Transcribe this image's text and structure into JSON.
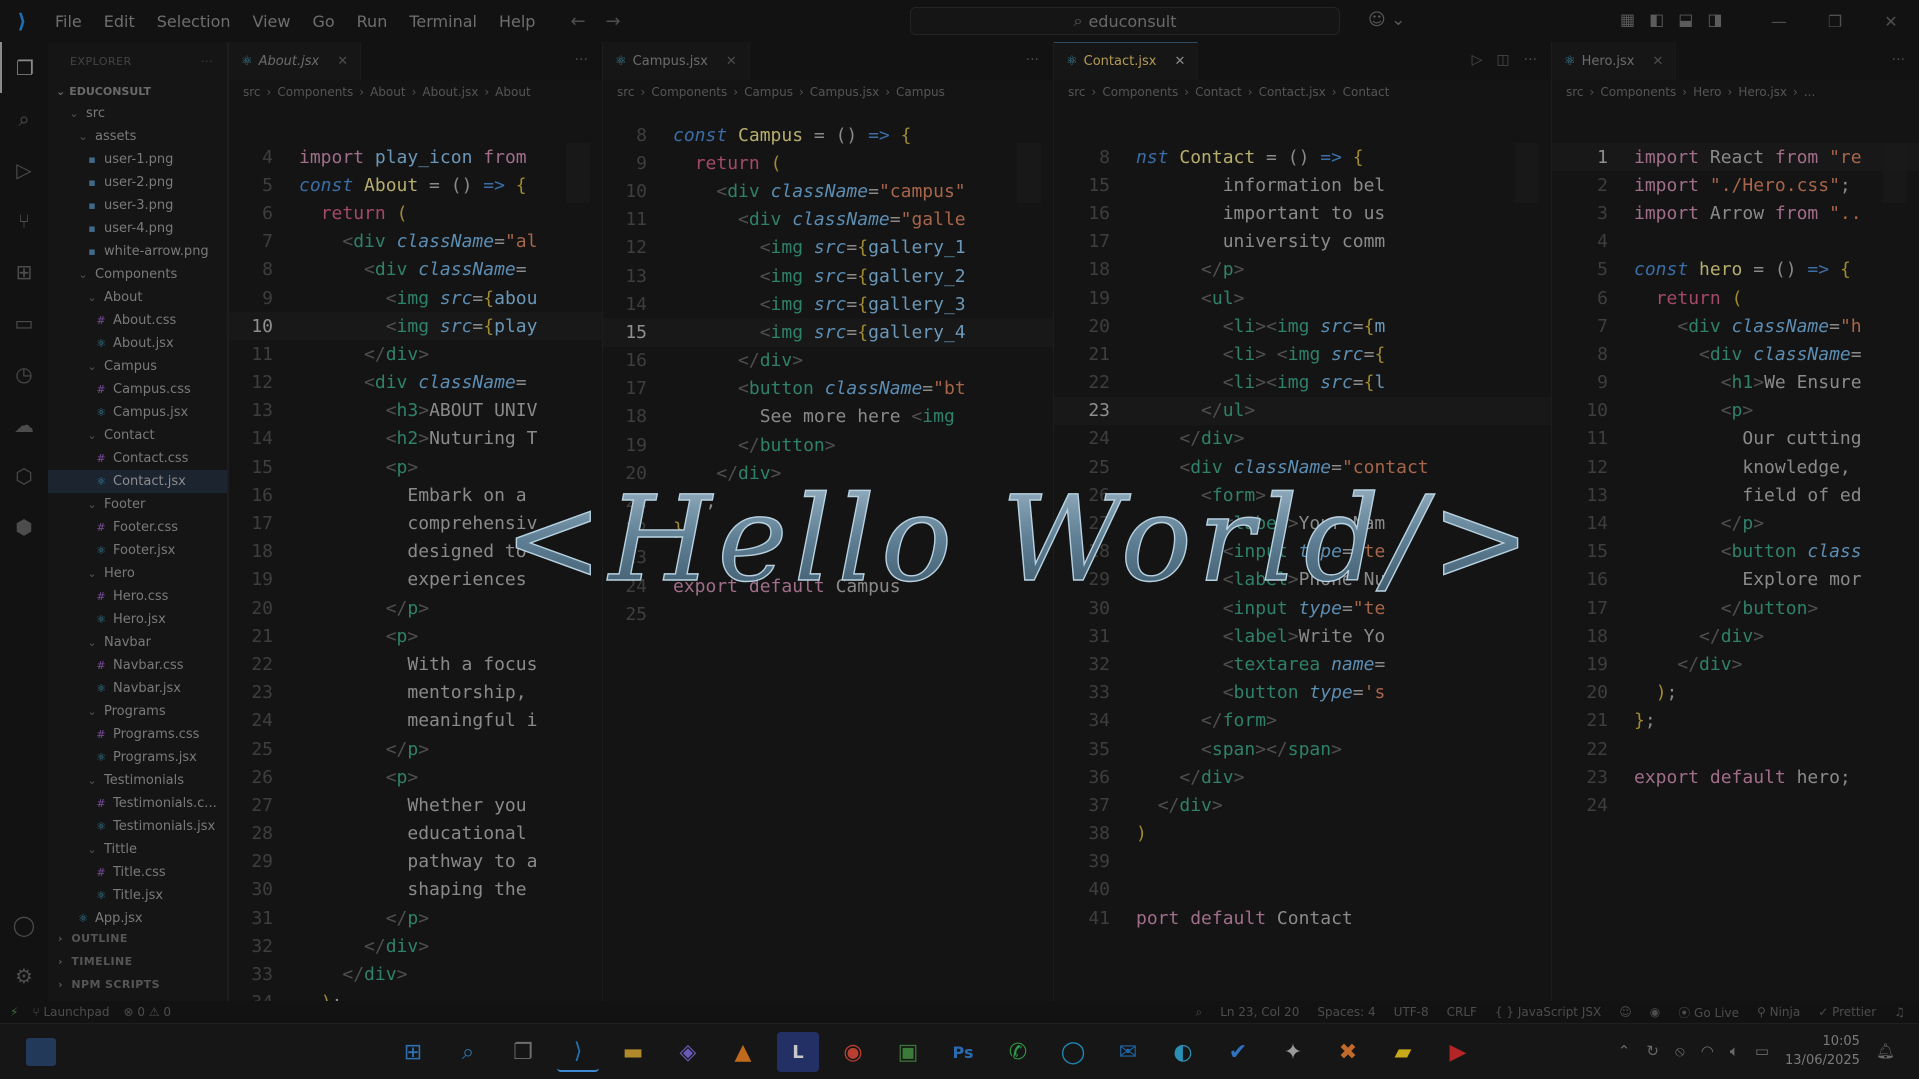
{
  "titlebar": {
    "menu": [
      "File",
      "Edit",
      "Selection",
      "View",
      "Go",
      "Run",
      "Terminal",
      "Help"
    ],
    "search": "educonsult"
  },
  "explorer": {
    "header": "EXPLORER",
    "root": "EDUCONSULT",
    "items": [
      {
        "label": "src",
        "depth": 1,
        "type": "folder-open"
      },
      {
        "label": "assets",
        "depth": 2,
        "type": "folder-open"
      },
      {
        "label": "user-1.png",
        "depth": 3,
        "type": "image"
      },
      {
        "label": "user-2.png",
        "depth": 3,
        "type": "image"
      },
      {
        "label": "user-3.png",
        "depth": 3,
        "type": "image"
      },
      {
        "label": "user-4.png",
        "depth": 3,
        "type": "image"
      },
      {
        "label": "white-arrow.png",
        "depth": 3,
        "type": "image"
      },
      {
        "label": "Components",
        "depth": 2,
        "type": "folder-open"
      },
      {
        "label": "About",
        "depth": 3,
        "type": "folder-open"
      },
      {
        "label": "About.css",
        "depth": 4,
        "type": "css"
      },
      {
        "label": "About.jsx",
        "depth": 4,
        "type": "jsx"
      },
      {
        "label": "Campus",
        "depth": 3,
        "type": "folder-open"
      },
      {
        "label": "Campus.css",
        "depth": 4,
        "type": "css"
      },
      {
        "label": "Campus.jsx",
        "depth": 4,
        "type": "jsx"
      },
      {
        "label": "Contact",
        "depth": 3,
        "type": "folder-open"
      },
      {
        "label": "Contact.css",
        "depth": 4,
        "type": "css"
      },
      {
        "label": "Contact.jsx",
        "depth": 4,
        "type": "jsx",
        "selected": true
      },
      {
        "label": "Footer",
        "depth": 3,
        "type": "folder-open"
      },
      {
        "label": "Footer.css",
        "depth": 4,
        "type": "css"
      },
      {
        "label": "Footer.jsx",
        "depth": 4,
        "type": "jsx"
      },
      {
        "label": "Hero",
        "depth": 3,
        "type": "folder-open"
      },
      {
        "label": "Hero.css",
        "depth": 4,
        "type": "css"
      },
      {
        "label": "Hero.jsx",
        "depth": 4,
        "type": "jsx"
      },
      {
        "label": "Navbar",
        "depth": 3,
        "type": "folder-open"
      },
      {
        "label": "Navbar.css",
        "depth": 4,
        "type": "css"
      },
      {
        "label": "Navbar.jsx",
        "depth": 4,
        "type": "jsx"
      },
      {
        "label": "Programs",
        "depth": 3,
        "type": "folder-open"
      },
      {
        "label": "Programs.css",
        "depth": 4,
        "type": "css"
      },
      {
        "label": "Programs.jsx",
        "depth": 4,
        "type": "jsx"
      },
      {
        "label": "Testimonials",
        "depth": 3,
        "type": "folder-open"
      },
      {
        "label": "Testimonials.c...",
        "depth": 4,
        "type": "css"
      },
      {
        "label": "Testimonials.jsx",
        "depth": 4,
        "type": "jsx"
      },
      {
        "label": "Tittle",
        "depth": 3,
        "type": "folder-open"
      },
      {
        "label": "Title.css",
        "depth": 4,
        "type": "css"
      },
      {
        "label": "Title.jsx",
        "depth": 4,
        "type": "jsx"
      },
      {
        "label": "App.jsx",
        "depth": 2,
        "type": "jsx"
      }
    ],
    "sections": [
      "OUTLINE",
      "TIMELINE",
      "NPM SCRIPTS"
    ]
  },
  "editors": [
    {
      "tab": "About.jsx",
      "crumbs": [
        "src",
        "Components",
        "About",
        "About.jsx",
        "About"
      ],
      "current_line": 10,
      "lines": [
        {
          "n": 4,
          "html": "<span class='k'>import</span> <span class='v'>play_icon</span> <span class='k'>from</span>"
        },
        {
          "n": 5,
          "html": "<span class='d'>const</span> <span class='fn'>About</span> = () <span class='d'>=&gt;</span> <span class='br'>{</span>"
        },
        {
          "n": 6,
          "html": "  <span class='ret'>return</span> <span class='br'>(</span>"
        },
        {
          "n": 7,
          "html": "    <span class='ang'>&lt;</span><span class='t'>div</span> <span class='a'>className</span>=<span class='s'>\"al</span>"
        },
        {
          "n": 8,
          "html": "      <span class='ang'>&lt;</span><span class='t'>div</span> <span class='a'>className</span>="
        },
        {
          "n": 9,
          "html": "        <span class='ang'>&lt;</span><span class='t'>img</span> <span class='a'>src</span>=<span class='br'>{</span><span class='v'>abou</span>"
        },
        {
          "n": 10,
          "html": "        <span class='ang'>&lt;</span><span class='t'>img</span> <span class='a'>src</span>=<span class='br'>{</span><span class='v'>play</span>"
        },
        {
          "n": 11,
          "html": "      <span class='ang'>&lt;/</span><span class='t'>div</span><span class='ang'>&gt;</span>"
        },
        {
          "n": 12,
          "html": "      <span class='ang'>&lt;</span><span class='t'>div</span> <span class='a'>className</span>="
        },
        {
          "n": 13,
          "html": "        <span class='ang'>&lt;</span><span class='t'>h3</span><span class='ang'>&gt;</span>ABOUT UNIV"
        },
        {
          "n": 14,
          "html": "        <span class='ang'>&lt;</span><span class='t'>h2</span><span class='ang'>&gt;</span>Nuturing T"
        },
        {
          "n": 15,
          "html": "        <span class='ang'>&lt;</span><span class='t'>p</span><span class='ang'>&gt;</span>"
        },
        {
          "n": 16,
          "html": "          Embark on a"
        },
        {
          "n": 17,
          "html": "          comprehensiv"
        },
        {
          "n": 18,
          "html": "          designed to"
        },
        {
          "n": 19,
          "html": "          experiences"
        },
        {
          "n": 20,
          "html": "        <span class='ang'>&lt;/</span><span class='t'>p</span><span class='ang'>&gt;</span>"
        },
        {
          "n": 21,
          "html": "        <span class='ang'>&lt;</span><span class='t'>p</span><span class='ang'>&gt;</span>"
        },
        {
          "n": 22,
          "html": "          With a focus"
        },
        {
          "n": 23,
          "html": "          mentorship,"
        },
        {
          "n": 24,
          "html": "          meaningful i"
        },
        {
          "n": 25,
          "html": "        <span class='ang'>&lt;/</span><span class='t'>p</span><span class='ang'>&gt;</span>"
        },
        {
          "n": 26,
          "html": "        <span class='ang'>&lt;</span><span class='t'>p</span><span class='ang'>&gt;</span>"
        },
        {
          "n": 27,
          "html": "          Whether you"
        },
        {
          "n": 28,
          "html": "          educational"
        },
        {
          "n": 29,
          "html": "          pathway to a"
        },
        {
          "n": 30,
          "html": "          shaping the"
        },
        {
          "n": 31,
          "html": "        <span class='ang'>&lt;/</span><span class='t'>p</span><span class='ang'>&gt;</span>"
        },
        {
          "n": 32,
          "html": "      <span class='ang'>&lt;/</span><span class='t'>div</span><span class='ang'>&gt;</span>"
        },
        {
          "n": 33,
          "html": "    <span class='ang'>&lt;/</span><span class='t'>div</span><span class='ang'>&gt;</span>"
        },
        {
          "n": 34,
          "html": "  <span class='br'>)</span>;"
        },
        {
          "n": 35,
          "html": "<span class='br'>}</span>;"
        }
      ]
    },
    {
      "tab": "Campus.jsx",
      "crumbs": [
        "src",
        "Components",
        "Campus",
        "Campus.jsx",
        "Campus"
      ],
      "current_line": 15,
      "lines": [
        {
          "n": 8,
          "html": "<span class='d'>const</span> <span class='fn'>Campus</span> = () <span class='d'>=&gt;</span> <span class='br'>{</span>"
        },
        {
          "n": 9,
          "html": "  <span class='ret'>return</span> <span class='br'>(</span>"
        },
        {
          "n": 10,
          "html": "    <span class='ang'>&lt;</span><span class='t'>div</span> <span class='a'>className</span>=<span class='s'>\"campus\"</span>"
        },
        {
          "n": 11,
          "html": "      <span class='ang'>&lt;</span><span class='t'>div</span> <span class='a'>className</span>=<span class='s'>\"galle</span>"
        },
        {
          "n": 12,
          "html": "        <span class='ang'>&lt;</span><span class='t'>img</span> <span class='a'>src</span>=<span class='br'>{</span><span class='v'>gallery_1</span>"
        },
        {
          "n": 13,
          "html": "        <span class='ang'>&lt;</span><span class='t'>img</span> <span class='a'>src</span>=<span class='br'>{</span><span class='v'>gallery_2</span>"
        },
        {
          "n": 14,
          "html": "        <span class='ang'>&lt;</span><span class='t'>img</span> <span class='a'>src</span>=<span class='br'>{</span><span class='v'>gallery_3</span>"
        },
        {
          "n": 15,
          "html": "        <span class='ang'>&lt;</span><span class='t'>img</span> <span class='a'>src</span>=<span class='br'>{</span><span class='v'>gallery_4</span>"
        },
        {
          "n": 16,
          "html": "      <span class='ang'>&lt;/</span><span class='t'>div</span><span class='ang'>&gt;</span>"
        },
        {
          "n": 17,
          "html": "      <span class='ang'>&lt;</span><span class='t'>button</span> <span class='a'>className</span>=<span class='s'>\"bt</span>"
        },
        {
          "n": 18,
          "html": "        See more here <span class='ang'>&lt;</span><span class='t'>img</span>"
        },
        {
          "n": 19,
          "html": "      <span class='ang'>&lt;/</span><span class='t'>button</span><span class='ang'>&gt;</span>"
        },
        {
          "n": 20,
          "html": "    <span class='ang'>&lt;/</span><span class='t'>div</span><span class='ang'>&gt;</span>"
        },
        {
          "n": 21,
          "html": "  <span class='br'>)</span>;"
        },
        {
          "n": 22,
          "html": "<span class='br'>}</span>"
        },
        {
          "n": 23,
          "html": ""
        },
        {
          "n": 24,
          "html": "<span class='k'>export</span> <span class='k'>default</span> Campus"
        },
        {
          "n": 25,
          "html": ""
        }
      ]
    },
    {
      "tab": "Contact.jsx",
      "crumbs": [
        "src",
        "Components",
        "Contact",
        "Contact.jsx",
        "Contact"
      ],
      "current_line": 23,
      "lines": [
        {
          "n": 8,
          "html": "<span class='d'>nst</span> <span class='fn'>Contact</span> = () <span class='d'>=&gt;</span> <span class='br'>{</span>"
        },
        {
          "n": 15,
          "html": "        information bel"
        },
        {
          "n": 16,
          "html": "        important to us"
        },
        {
          "n": 17,
          "html": "        university comm"
        },
        {
          "n": 18,
          "html": "      <span class='ang'>&lt;/</span><span class='t'>p</span><span class='ang'>&gt;</span>"
        },
        {
          "n": 19,
          "html": "      <span class='ang'>&lt;</span><span class='t'>ul</span><span class='ang'>&gt;</span>"
        },
        {
          "n": 20,
          "html": "        <span class='ang'>&lt;</span><span class='t'>li</span><span class='ang'>&gt;&lt;</span><span class='t'>img</span> <span class='a'>src</span>=<span class='br'>{</span><span class='v'>m</span>"
        },
        {
          "n": 21,
          "html": "        <span class='ang'>&lt;</span><span class='t'>li</span><span class='ang'>&gt;</span> <span class='ang'>&lt;</span><span class='t'>img</span> <span class='a'>src</span>=<span class='br'>{</span>"
        },
        {
          "n": 22,
          "html": "        <span class='ang'>&lt;</span><span class='t'>li</span><span class='ang'>&gt;&lt;</span><span class='t'>img</span> <span class='a'>src</span>=<span class='br'>{</span><span class='v'>l</span>"
        },
        {
          "n": 23,
          "html": "      <span class='ang'>&lt;/</span><span class='t'>ul</span><span class='ang'>&gt;</span>"
        },
        {
          "n": 24,
          "html": "    <span class='ang'>&lt;/</span><span class='t'>div</span><span class='ang'>&gt;</span>"
        },
        {
          "n": 25,
          "html": "    <span class='ang'>&lt;</span><span class='t'>div</span> <span class='a'>className</span>=<span class='s'>\"contact</span>"
        },
        {
          "n": 26,
          "html": "      <span class='ang'>&lt;</span><span class='t'>form</span><span class='ang'>&gt;</span>"
        },
        {
          "n": 27,
          "html": "        <span class='ang'>&lt;</span><span class='t'>label</span><span class='ang'>&gt;</span>Your Nam"
        },
        {
          "n": 28,
          "html": "        <span class='ang'>&lt;</span><span class='t'>input</span> <span class='a'>type</span>=<span class='s'>\"te</span>"
        },
        {
          "n": 29,
          "html": "        <span class='ang'>&lt;</span><span class='t'>label</span><span class='ang'>&gt;</span>Phone Nu"
        },
        {
          "n": 30,
          "html": "        <span class='ang'>&lt;</span><span class='t'>input</span> <span class='a'>type</span>=<span class='s'>\"te</span>"
        },
        {
          "n": 31,
          "html": "        <span class='ang'>&lt;</span><span class='t'>label</span><span class='ang'>&gt;</span>Write Yo"
        },
        {
          "n": 32,
          "html": "        <span class='ang'>&lt;</span><span class='t'>textarea</span> <span class='a'>name</span>="
        },
        {
          "n": 33,
          "html": "        <span class='ang'>&lt;</span><span class='t'>button</span> <span class='a'>type</span>=<span class='s'>'s</span>"
        },
        {
          "n": 34,
          "html": "      <span class='ang'>&lt;/</span><span class='t'>form</span><span class='ang'>&gt;</span>"
        },
        {
          "n": 35,
          "html": "      <span class='ang'>&lt;</span><span class='t'>span</span><span class='ang'>&gt;&lt;/</span><span class='t'>span</span><span class='ang'>&gt;</span>"
        },
        {
          "n": 36,
          "html": "    <span class='ang'>&lt;/</span><span class='t'>div</span><span class='ang'>&gt;</span>"
        },
        {
          "n": 37,
          "html": "  <span class='ang'>&lt;/</span><span class='t'>div</span><span class='ang'>&gt;</span>"
        },
        {
          "n": 38,
          "html": "<span class='br'>)</span>"
        },
        {
          "n": 39,
          "html": ""
        },
        {
          "n": 40,
          "html": ""
        },
        {
          "n": 41,
          "html": "<span class='k'>port</span> <span class='k'>default</span> Contact"
        }
      ]
    },
    {
      "tab": "Hero.jsx",
      "crumbs": [
        "src",
        "Components",
        "Hero",
        "Hero.jsx",
        "..."
      ],
      "current_line": 1,
      "lines": [
        {
          "n": 1,
          "html": "<span class='k'>import</span> React <span class='k'>from</span> <span class='s'>\"re</span>"
        },
        {
          "n": 2,
          "html": "<span class='k'>import</span> <span class='s'>\"./Hero.css\"</span>;"
        },
        {
          "n": 3,
          "html": "<span class='k'>import</span> Arrow <span class='k'>from</span> <span class='s'>\"..</span>"
        },
        {
          "n": 4,
          "html": ""
        },
        {
          "n": 5,
          "html": "<span class='d'>const</span> <span class='fn'>hero</span> = () <span class='d'>=&gt;</span> <span class='br'>{</span>"
        },
        {
          "n": 6,
          "html": "  <span class='ret'>return</span> <span class='br'>(</span>"
        },
        {
          "n": 7,
          "html": "    <span class='ang'>&lt;</span><span class='t'>div</span> <span class='a'>className</span>=<span class='s'>\"h</span>"
        },
        {
          "n": 8,
          "html": "      <span class='ang'>&lt;</span><span class='t'>div</span> <span class='a'>className</span>="
        },
        {
          "n": 9,
          "html": "        <span class='ang'>&lt;</span><span class='t'>h1</span><span class='ang'>&gt;</span>We Ensure"
        },
        {
          "n": 10,
          "html": "        <span class='ang'>&lt;</span><span class='t'>p</span><span class='ang'>&gt;</span>"
        },
        {
          "n": 11,
          "html": "          Our cutting"
        },
        {
          "n": 12,
          "html": "          knowledge,"
        },
        {
          "n": 13,
          "html": "          field of ed"
        },
        {
          "n": 14,
          "html": "        <span class='ang'>&lt;/</span><span class='t'>p</span><span class='ang'>&gt;</span>"
        },
        {
          "n": 15,
          "html": "        <span class='ang'>&lt;</span><span class='t'>button</span> <span class='a'>class</span>"
        },
        {
          "n": 16,
          "html": "          Explore mor"
        },
        {
          "n": 17,
          "html": "        <span class='ang'>&lt;/</span><span class='t'>button</span><span class='ang'>&gt;</span>"
        },
        {
          "n": 18,
          "html": "      <span class='ang'>&lt;/</span><span class='t'>div</span><span class='ang'>&gt;</span>"
        },
        {
          "n": 19,
          "html": "    <span class='ang'>&lt;/</span><span class='t'>div</span><span class='ang'>&gt;</span>"
        },
        {
          "n": 20,
          "html": "  <span class='br'>)</span>;"
        },
        {
          "n": 21,
          "html": "<span class='br'>}</span>;"
        },
        {
          "n": 22,
          "html": ""
        },
        {
          "n": 23,
          "html": "<span class='k'>export</span> <span class='k'>default</span> hero;"
        },
        {
          "n": 24,
          "html": ""
        }
      ]
    }
  ],
  "status": {
    "launchpad": "Launchpad",
    "problems": "⊗ 0 ⚠ 0",
    "position": "Ln 23, Col 20",
    "spaces": "Spaces: 4",
    "encoding": "UTF-8",
    "eol": "CRLF",
    "language": "JavaScript JSX",
    "golive": "Go Live",
    "ninja": "Ninja",
    "prettier": "Prettier"
  },
  "overlay": {
    "text": "<Hello World/>"
  },
  "taskbar": {
    "time": "10:05",
    "date": "13/06/2025"
  }
}
